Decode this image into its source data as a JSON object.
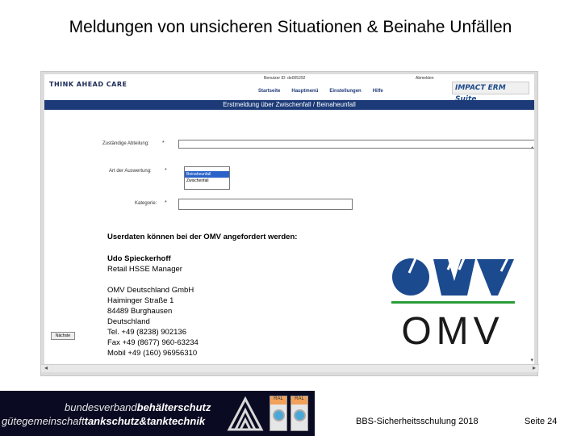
{
  "slide": {
    "title": "Meldungen von unsicheren Situationen & Beinahe Unfällen"
  },
  "app": {
    "logo_text": "THINK AHEAD CARE",
    "user_line": "Benutzer ID: de005292",
    "logout": "Abmelden",
    "suite": "IMPACT ERM Suite",
    "nav": [
      "Startseite",
      "Hauptmenü",
      "Einstellungen",
      "Hilfe"
    ],
    "form_title": "Erstmeldung über Zwischenfall / Beinaheunfall",
    "fields": {
      "department_label": "Zuständige Abteilung:",
      "evaluation_label": "Art der Auswertung:",
      "category_label": "Kategorie:",
      "required_mark": "*"
    },
    "evaluation_options": [
      "Beinaheunfall",
      "Zwischenfall"
    ],
    "next_button": "Nächste"
  },
  "overlay": {
    "heading": "Userdaten können bei der OMV angefordert werden:",
    "name": "Udo Spieckerhoff",
    "role": "Retail HSSE Manager",
    "company": "OMV Deutschland GmbH",
    "street": "Haiminger Straße 1",
    "city": "84489 Burghausen",
    "country": "Deutschland",
    "tel": "Tel. +49 (8238) 902136",
    "fax": "Fax +49 (8677) 960-63234",
    "mobil": "Mobil +49 (160) 96956310",
    "omv_logo_text": "OMV"
  },
  "footer": {
    "banner_line1_a": "bundesverband",
    "banner_line1_b": "behälterschutz",
    "banner_line2_a": "gütegemeinschaft",
    "banner_line2_b": "tankschutz&tanktechnik",
    "badge1": "RAL",
    "badge2": "RAL",
    "event": "BBS-Sicherheitsschulung 2018",
    "page": "Seite 24"
  }
}
